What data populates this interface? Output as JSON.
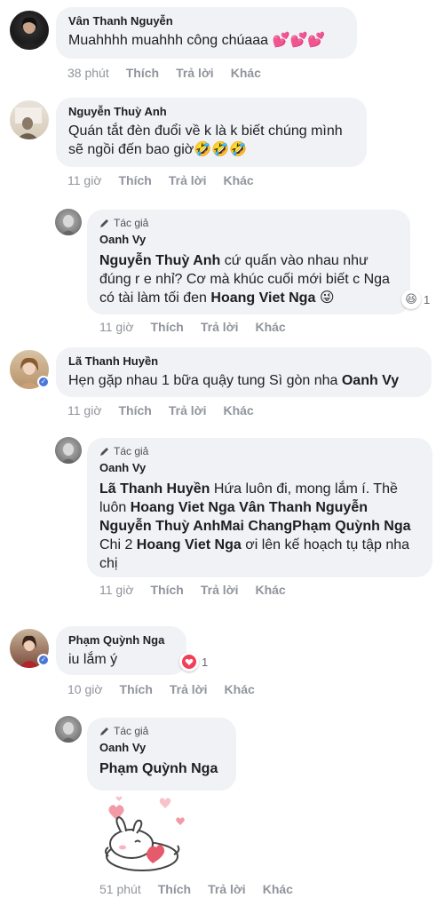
{
  "actions": {
    "like": "Thích",
    "reply": "Trả lời",
    "more": "Khác"
  },
  "author_badge": "Tác giả",
  "comments": [
    {
      "name": "Vân Thanh Nguyễn",
      "text": "Muahhhh muahhh công chúaaa",
      "emoji": "💕💕💕",
      "time": "38 phút"
    },
    {
      "name": "Nguyễn Thuỳ Anh",
      "text": "Quán tắt đèn đuổi về k là k biết chúng mình sẽ ngồi đến bao giờ",
      "emoji": "🤣🤣🤣",
      "time": "11 giờ"
    },
    {
      "name": "Oanh Vy",
      "mention": "Nguyễn Thuỳ Anh",
      "text_a": " cứ quấn vào nhau như đúng r e nhỉ? Cơ mà khúc cuối mới biết c Nga có tài làm tối đen ",
      "mention2": "Hoang Viet Nga",
      "emoji": "😜",
      "time": "11 giờ",
      "reaction_count": "1"
    },
    {
      "name": "Lã Thanh Huyền",
      "text": "Hẹn gặp nhau 1 bữa quậy tung Sì gòn nha ",
      "mention": "Oanh Vy",
      "time": "11 giờ"
    },
    {
      "name": "Oanh Vy",
      "mention": "Lã Thanh Huyền",
      "text_a": " Hứa luôn đi, mong lắm í. Thề luôn ",
      "mention2": "Hoang Viet Nga Vân Thanh Nguyễn Nguyễn Thuỳ AnhMai ChangPhạm Quỳnh Nga",
      "text_b": " Chi 2 ",
      "mention3": "Hoang Viet Nga",
      "text_c": " ơi lên kế hoạch tụ tập nha chị",
      "time": "11 giờ"
    },
    {
      "name": "Phạm Quỳnh Nga",
      "text": "iu lắm ý",
      "time": "10 giờ",
      "reaction_count": "1"
    },
    {
      "name": "Oanh Vy",
      "mention": "Phạm Quỳnh Nga",
      "time": "51 phút"
    }
  ]
}
